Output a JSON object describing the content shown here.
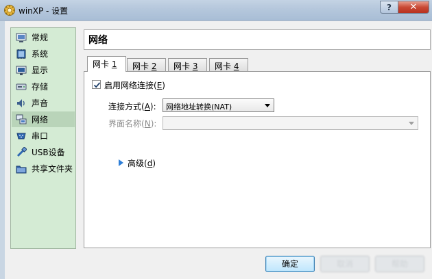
{
  "window": {
    "title": "winXP - 设置",
    "help_label": "?",
    "close_label": "✕"
  },
  "sidebar": {
    "items": [
      {
        "label": "常规",
        "icon": "general-icon"
      },
      {
        "label": "系统",
        "icon": "system-icon"
      },
      {
        "label": "显示",
        "icon": "display-icon"
      },
      {
        "label": "存储",
        "icon": "storage-icon"
      },
      {
        "label": "声音",
        "icon": "audio-icon"
      },
      {
        "label": "网络",
        "icon": "network-icon",
        "selected": true
      },
      {
        "label": "串口",
        "icon": "serial-port-icon"
      },
      {
        "label": "USB设备",
        "icon": "usb-icon"
      },
      {
        "label": "共享文件夹",
        "icon": "shared-folder-icon"
      }
    ]
  },
  "main": {
    "title": "网络",
    "tabs": [
      {
        "prefix": "网卡 ",
        "num": "1"
      },
      {
        "prefix": "网卡 ",
        "num": "2"
      },
      {
        "prefix": "网卡 ",
        "num": "3"
      },
      {
        "prefix": "网卡 ",
        "num": "4"
      }
    ],
    "enable_checkbox": {
      "label": "启用网络连接",
      "accel": "E",
      "checked": true
    },
    "attachment": {
      "label": "连接方式",
      "accel": "A",
      "value": "网络地址转换(NAT)"
    },
    "interface_name": {
      "label": "界面名称",
      "accel": "N",
      "value": ""
    },
    "advanced": {
      "label": "高级",
      "accel": "d"
    }
  },
  "buttons": {
    "ok": "确定",
    "cancel": "取消",
    "help": "帮助"
  },
  "colors": {
    "sidebar_bg": "#d4ebd4",
    "titlebar": "#b5c7dc",
    "close_red": "#c94a35",
    "accent_blue": "#2f7fd8"
  }
}
